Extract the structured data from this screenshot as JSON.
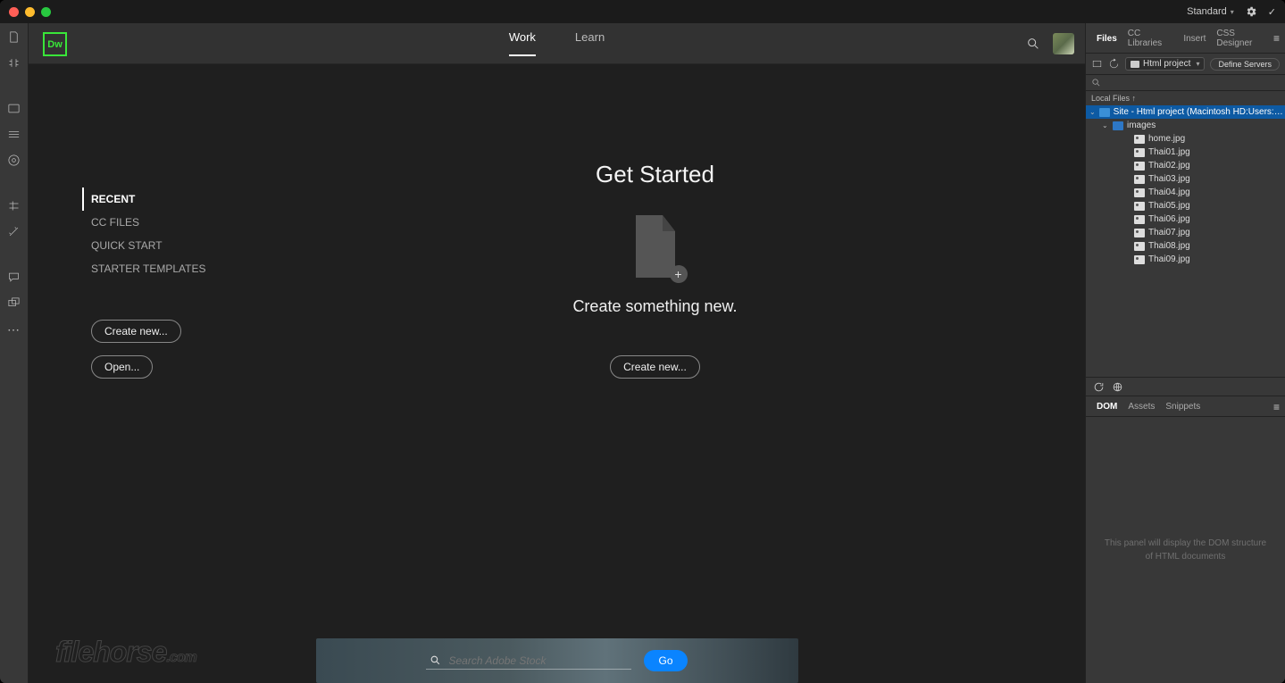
{
  "titlebar": {
    "workspace": "Standard"
  },
  "topbar": {
    "tabs": {
      "work": "Work",
      "learn": "Learn"
    }
  },
  "sidebar": {
    "cats": {
      "recent": "RECENT",
      "ccfiles": "CC FILES",
      "quickstart": "QUICK START",
      "templates": "STARTER TEMPLATES"
    },
    "create": "Create new...",
    "open": "Open..."
  },
  "center": {
    "title": "Get Started",
    "subtitle": "Create something new.",
    "create": "Create new..."
  },
  "stock": {
    "placeholder": "Search Adobe Stock",
    "go": "Go"
  },
  "filesPanel": {
    "tabs": {
      "files": "Files",
      "cc": "CC Libraries",
      "insert": "Insert",
      "css": "CSS Designer"
    },
    "project": "Html project",
    "define": "Define Servers",
    "localLabel": "Local Files ↑",
    "siteLabel": "Site - Html project (Macintosh HD:Users:Eug...",
    "folder": "images",
    "files": [
      "home.jpg",
      "Thai01.jpg",
      "Thai02.jpg",
      "Thai03.jpg",
      "Thai04.jpg",
      "Thai05.jpg",
      "Thai06.jpg",
      "Thai07.jpg",
      "Thai08.jpg",
      "Thai09.jpg"
    ]
  },
  "domPanel": {
    "tabs": {
      "dom": "DOM",
      "assets": "Assets",
      "snippets": "Snippets"
    },
    "msg": "This panel will display the DOM structure of HTML documents"
  },
  "watermark": "filehorse",
  "watermark_suffix": ".com"
}
